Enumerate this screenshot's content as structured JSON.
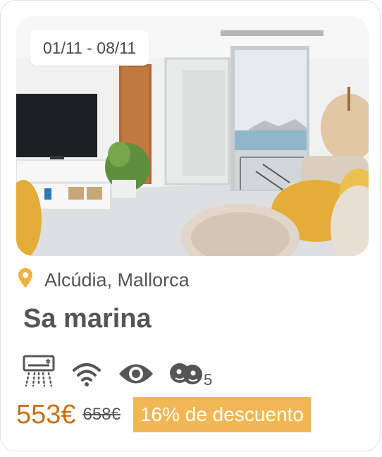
{
  "listing": {
    "dates": "01/11 - 08/11",
    "location": "Alcúdia, Mallorca",
    "title": "Sa marina",
    "guests": "5",
    "price": "553€",
    "old_price": "658€",
    "discount": "16% de descuento"
  },
  "amenities": [
    "air-conditioning-icon",
    "wifi-icon",
    "view-icon",
    "guests-icon"
  ],
  "colors": {
    "price": "#c5721a",
    "discount_bg": "#f2b755",
    "pin": "#f0b13f",
    "icon": "#555555"
  }
}
